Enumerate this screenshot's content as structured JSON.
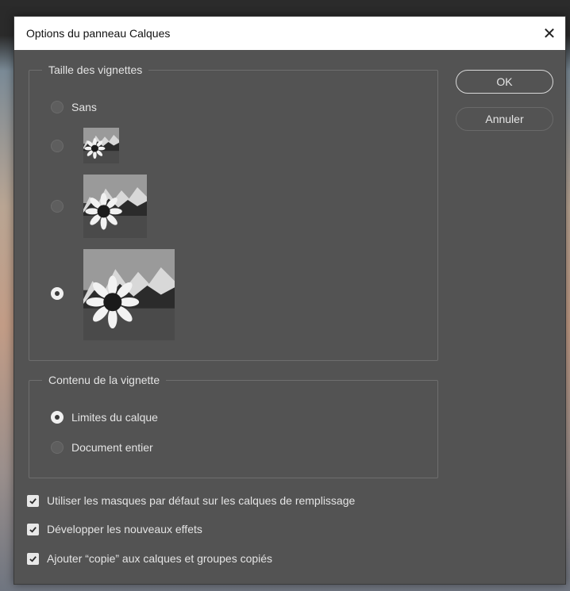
{
  "window": {
    "title": "Options du panneau Calques",
    "close_glyph": "✕"
  },
  "thumbnail_size": {
    "legend": "Taille des vignettes",
    "options": [
      {
        "label": "Sans",
        "checked": false
      },
      {
        "label": "",
        "checked": false
      },
      {
        "label": "",
        "checked": false
      },
      {
        "label": "",
        "checked": true
      }
    ]
  },
  "thumbnail_content": {
    "legend": "Contenu de la vignette",
    "options": [
      {
        "label": "Limites du calque",
        "checked": true
      },
      {
        "label": "Document entier",
        "checked": false
      }
    ]
  },
  "buttons": {
    "ok": "OK",
    "cancel": "Annuler"
  },
  "checkboxes": [
    {
      "label": "Utiliser les masques par défaut sur les calques de remplissage",
      "checked": true
    },
    {
      "label": "Développer les nouveaux effets",
      "checked": true
    },
    {
      "label": "Ajouter “copie” aux calques et groupes copiés",
      "checked": true
    }
  ],
  "icons": {
    "close": "close-icon",
    "check": "checkmark-icon",
    "thumbnail": "sunflower-thumbnail"
  }
}
